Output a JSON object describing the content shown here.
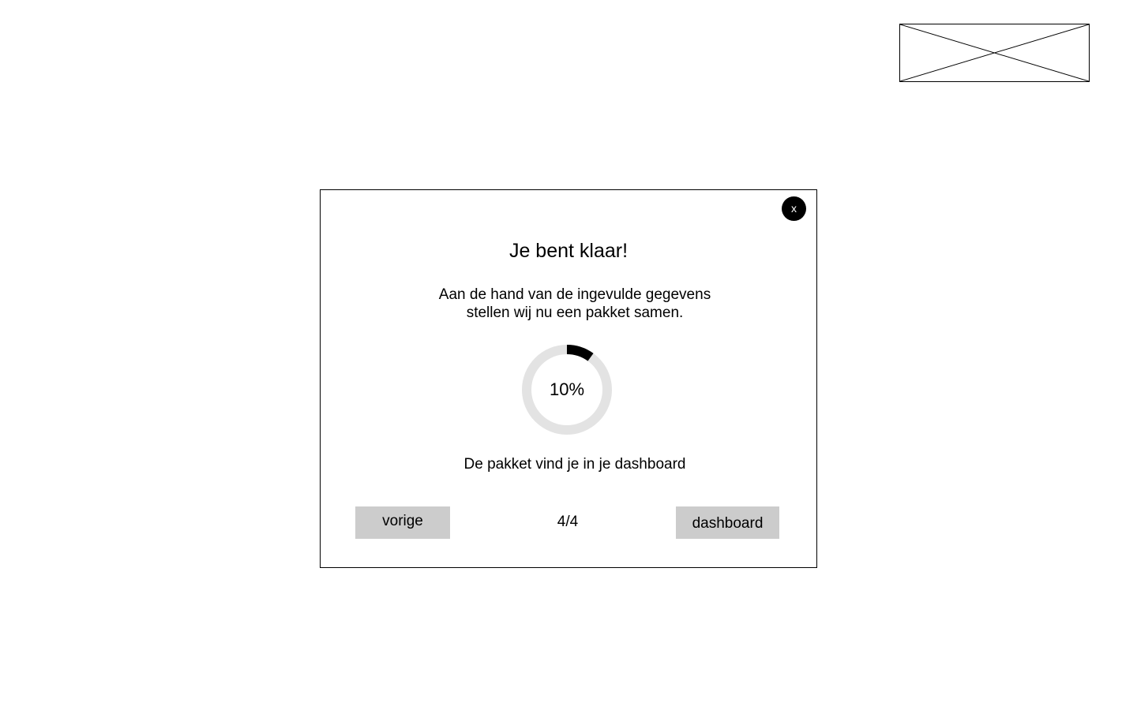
{
  "placeholder_image": {
    "kind": "image-placeholder-icon"
  },
  "modal": {
    "close_label": "x",
    "title": "Je bent klaar!",
    "message_line1": "Aan de hand van de ingevulde gegevens",
    "message_line2": "stellen wij nu een pakket samen.",
    "progress": {
      "value_percent": 10,
      "label": "10%",
      "track_color": "#e3e3e3",
      "fill_color": "#000000"
    },
    "footer_note": "De pakket vind je in je dashboard",
    "prev_label": "vorige",
    "step_label": "4/4",
    "dashboard_label": "dashboard"
  },
  "colors": {
    "button_bg": "#cccccc",
    "close_bg": "#000000"
  }
}
